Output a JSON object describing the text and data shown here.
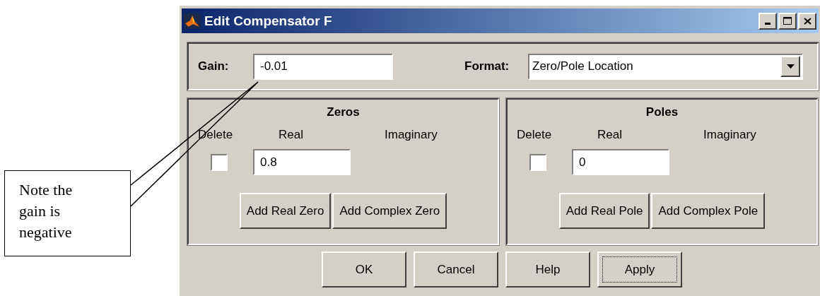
{
  "callout": {
    "text": "Note the gain is negative"
  },
  "window": {
    "title": "Edit Compensator F"
  },
  "gain": {
    "label": "Gain:",
    "value": "-0.01"
  },
  "format": {
    "label": "Format:",
    "value": "Zero/Pole Location"
  },
  "panels": [
    {
      "title": "Zeros",
      "headers": [
        "Delete",
        "Real",
        "Imaginary"
      ],
      "rows": [
        {
          "checked": false,
          "real": "0.8"
        }
      ],
      "buttons": [
        "Add Real Zero",
        "Add Complex Zero"
      ]
    },
    {
      "title": "Poles",
      "headers": [
        "Delete",
        "Real",
        "Imaginary"
      ],
      "rows": [
        {
          "checked": false,
          "real": "0"
        }
      ],
      "buttons": [
        "Add Real Pole",
        "Add Complex Pole"
      ]
    }
  ],
  "buttons": [
    {
      "label": "OK",
      "focused": false
    },
    {
      "label": "Cancel",
      "focused": false
    },
    {
      "label": "Help",
      "focused": false
    },
    {
      "label": "Apply",
      "focused": true
    }
  ]
}
